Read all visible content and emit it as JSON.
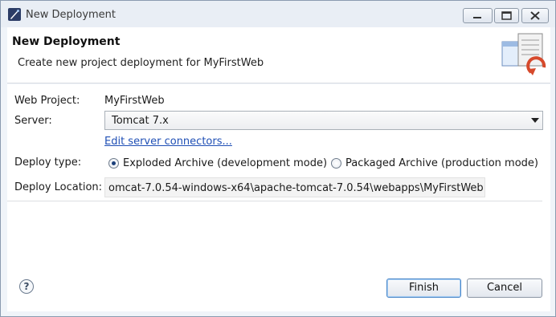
{
  "window": {
    "title": "New Deployment"
  },
  "header": {
    "title": "New Deployment",
    "description": "Create new project deployment for MyFirstWeb"
  },
  "form": {
    "web_project_label": "Web Project:",
    "web_project_value": "MyFirstWeb",
    "server_label": "Server:",
    "server_value": "Tomcat  7.x",
    "edit_link": "Edit server connectors...",
    "deploy_type_label": "Deploy type:",
    "deploy_options": [
      {
        "label": "Exploded Archive (development mode)",
        "selected": true
      },
      {
        "label": "Packaged Archive (production mode)",
        "selected": false
      }
    ],
    "deploy_location_label": "Deploy Location:",
    "deploy_location_value": "omcat-7.0.54-windows-x64\\apache-tomcat-7.0.54\\webapps\\MyFirstWeb"
  },
  "buttons": {
    "help": "?",
    "finish": "Finish",
    "cancel": "Cancel"
  },
  "icons": {
    "app": "eclipse-icon",
    "minimize": "minimize-icon",
    "maximize": "maximize-icon",
    "close": "close-icon",
    "wizard": "deploy-wizard-icon",
    "dropdown": "chevron-down-icon",
    "help": "help-icon"
  },
  "colors": {
    "link": "#1f4fb5",
    "finish_focus": "#4a86c8"
  }
}
